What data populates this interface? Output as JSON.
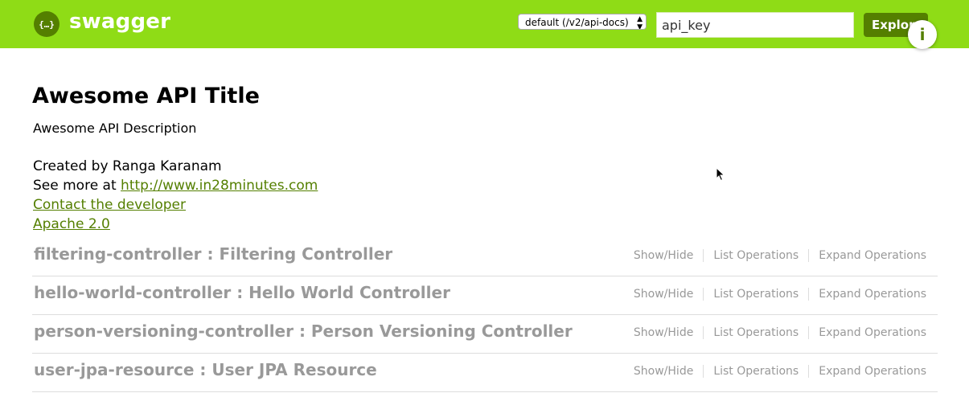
{
  "header": {
    "brand": "swagger",
    "spec_selector": "default (/v2/api-docs)",
    "api_key_value": "api_key",
    "explore_label": "Explore",
    "info_label": "i"
  },
  "info": {
    "title": "Awesome API Title",
    "description": "Awesome API Description",
    "created_by": "Created by Ranga Karanam",
    "see_more_prefix": "See more at ",
    "see_more_link": "http://www.in28minutes.com",
    "contact_link": "Contact the developer",
    "license_link": "Apache 2.0"
  },
  "resources": [
    {
      "name": "filtering-controller : Filtering Controller",
      "show_hide": "Show/Hide",
      "list_ops": "List Operations",
      "expand_ops": "Expand Operations"
    },
    {
      "name": "hello-world-controller : Hello World Controller",
      "show_hide": "Show/Hide",
      "list_ops": "List Operations",
      "expand_ops": "Expand Operations"
    },
    {
      "name": "person-versioning-controller : Person Versioning Controller",
      "show_hide": "Show/Hide",
      "list_ops": "List Operations",
      "expand_ops": "Expand Operations"
    },
    {
      "name": "user-jpa-resource : User JPA Resource",
      "show_hide": "Show/Hide",
      "list_ops": "List Operations",
      "expand_ops": "Expand Operations"
    }
  ],
  "colors": {
    "header_bg": "#8fdc16",
    "brand_dark": "#547f00",
    "resource_text": "#999999"
  },
  "icons": {
    "logo": "swagger-logo-icon",
    "selector_arrows": "updown-arrows-icon",
    "info": "info-icon",
    "cursor": "mouse-cursor-icon"
  }
}
